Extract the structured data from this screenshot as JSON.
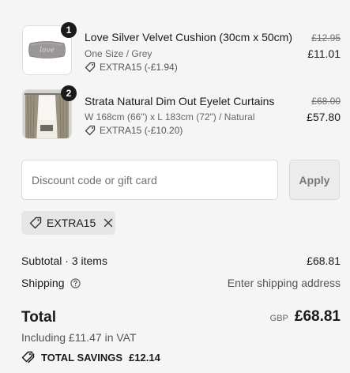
{
  "items": [
    {
      "quantity": "1",
      "name": "Love Silver Velvet Cushion (30cm x 50cm)",
      "variant": "One Size / Grey",
      "discount": "EXTRA15 (-£1.94)",
      "original_price": "£12.95",
      "price": "£11.01",
      "image_icon": "cushion-image"
    },
    {
      "quantity": "2",
      "name": "Strata Natural Dim Out Eyelet Curtains",
      "variant": "W 168cm (66\") x L 183cm (72\") / Natural",
      "discount": "EXTRA15 (-£10.20)",
      "original_price": "£68.00",
      "price": "£57.80",
      "image_icon": "curtains-image"
    }
  ],
  "discount_field": {
    "placeholder": "Discount code or gift card",
    "value": ""
  },
  "apply_label": "Apply",
  "applied_code": {
    "code": "EXTRA15",
    "icon": "tag-icon",
    "remove_icon": "close-icon"
  },
  "summary": {
    "subtotal_label": "Subtotal · 3 items",
    "subtotal_value": "£68.81",
    "shipping_label": "Shipping",
    "shipping_value": "Enter shipping address",
    "total_label": "Total",
    "currency": "GBP",
    "total_value": "£68.81",
    "vat_text": "Including £11.47 in VAT",
    "savings_label": "TOTAL SAVINGS",
    "savings_value": "£12.14"
  },
  "colors": {
    "background": "#f5f5f5",
    "text": "#1a1a1a",
    "muted": "#707070",
    "badge": "#1a1a1a"
  }
}
